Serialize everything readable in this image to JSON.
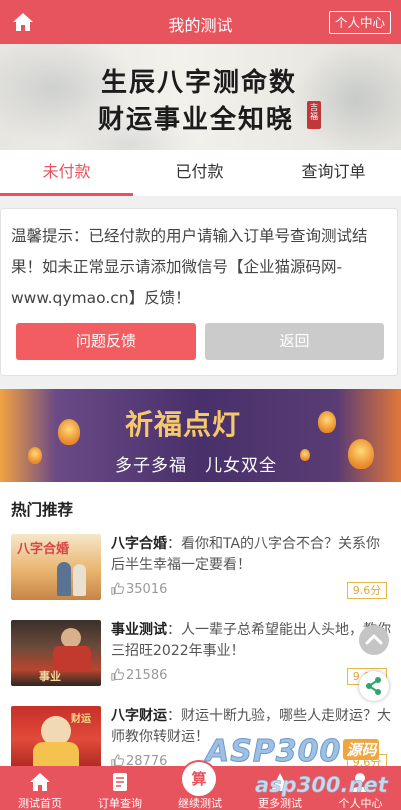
{
  "header": {
    "title": "我的测试",
    "user_center_label": "个人中心"
  },
  "banner_top": {
    "line1": "生辰八字测命数",
    "line2": "财运事业全知晓",
    "seal_text": "吉福"
  },
  "tabs": [
    {
      "label": "未付款",
      "active": true
    },
    {
      "label": "已付款",
      "active": false
    },
    {
      "label": "查询订单",
      "active": false
    }
  ],
  "tip": {
    "text": "温馨提示：已经付款的用户请输入订单号查询测试结果！如未正常显示请添加微信号【企业猫源码网-www.qymao.cn】反馈！",
    "feedback_label": "问题反馈",
    "back_label": "返回"
  },
  "banner_lamp": {
    "title": "祈福点灯",
    "subtitle": "多子多福　儿女双全"
  },
  "hot": {
    "title": "热门推荐",
    "items": [
      {
        "name": "八字合婚",
        "desc": "：看你和TA的八字合不合？关系你后半生幸福一定要看！",
        "views": "35016",
        "score": "9.6分",
        "thumb_caption": "八字合婚"
      },
      {
        "name": "事业测试",
        "desc": "：人一辈子总希望能出人头地，教你三招旺2022年事业！",
        "views": "21586",
        "score": "9.6分",
        "thumb_caption": "事业"
      },
      {
        "name": "八字财运",
        "desc": "：财运十断九验，哪些人走财运？大师教你转财运！",
        "views": "28776",
        "score": "9.6分",
        "thumb_caption": "财运"
      }
    ]
  },
  "watermark": {
    "main": "ASP300",
    "tag": "源码",
    "url": "asp300.net"
  },
  "bottom_nav": [
    {
      "label": "测试首页",
      "icon": "home-icon"
    },
    {
      "label": "订单查询",
      "icon": "order-icon"
    },
    {
      "label": "继续测试",
      "icon": "center-test-icon",
      "center_text": "算"
    },
    {
      "label": "更多测试",
      "icon": "more-icon"
    },
    {
      "label": "个人中心",
      "icon": "user-icon"
    }
  ],
  "colors": {
    "accent": "#e8545e",
    "score": "#e0a737"
  }
}
